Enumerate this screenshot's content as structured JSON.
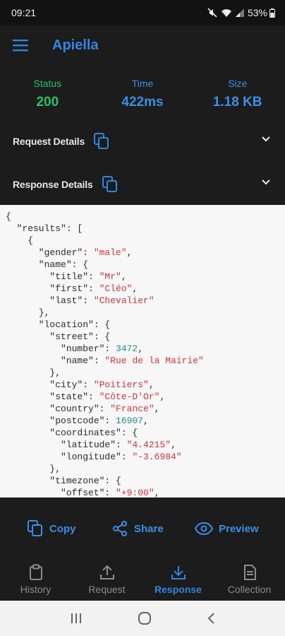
{
  "status_bar": {
    "time": "09:21",
    "battery": "53%"
  },
  "app": {
    "title": "Apiella"
  },
  "stats": [
    {
      "label": "Status",
      "value": "200"
    },
    {
      "label": "Time",
      "value": "422ms"
    },
    {
      "label": "Size",
      "value": "1.18 KB"
    }
  ],
  "sections": {
    "request": "Request Details",
    "response": "Response Details"
  },
  "response_body": [
    "{",
    "  \"results\": [",
    "    {",
    "      \"gender\": \"male\",",
    "      \"name\": {",
    "        \"title\": \"Mr\",",
    "        \"first\": \"Cléo\",",
    "        \"last\": \"Chevalier\"",
    "      },",
    "      \"location\": {",
    "        \"street\": {",
    "          \"number\": 3472,",
    "          \"name\": \"Rue de la Mairie\"",
    "        },",
    "        \"city\": \"Poitiers\",",
    "        \"state\": \"Côte-D'Or\",",
    "        \"country\": \"France\",",
    "        \"postcode\": 16907,",
    "        \"coordinates\": {",
    "          \"latitude\": \"4.4215\",",
    "          \"longitude\": \"-3.6984\"",
    "        },",
    "        \"timezone\": {",
    "          \"offset\": \"+9:00\","
  ],
  "actions": {
    "copy": "Copy",
    "share": "Share",
    "preview": "Preview"
  },
  "bottom_nav": [
    {
      "label": "History",
      "icon": "clipboard-icon",
      "active": false
    },
    {
      "label": "Request",
      "icon": "upload-icon",
      "active": false
    },
    {
      "label": "Response",
      "icon": "download-icon",
      "active": true
    },
    {
      "label": "Collection",
      "icon": "document-icon",
      "active": false
    }
  ],
  "colors": {
    "accent": "#2f86e0",
    "status_ok": "#27c26a",
    "background": "#1c1c1c",
    "code_bg": "#f7f7f7"
  }
}
